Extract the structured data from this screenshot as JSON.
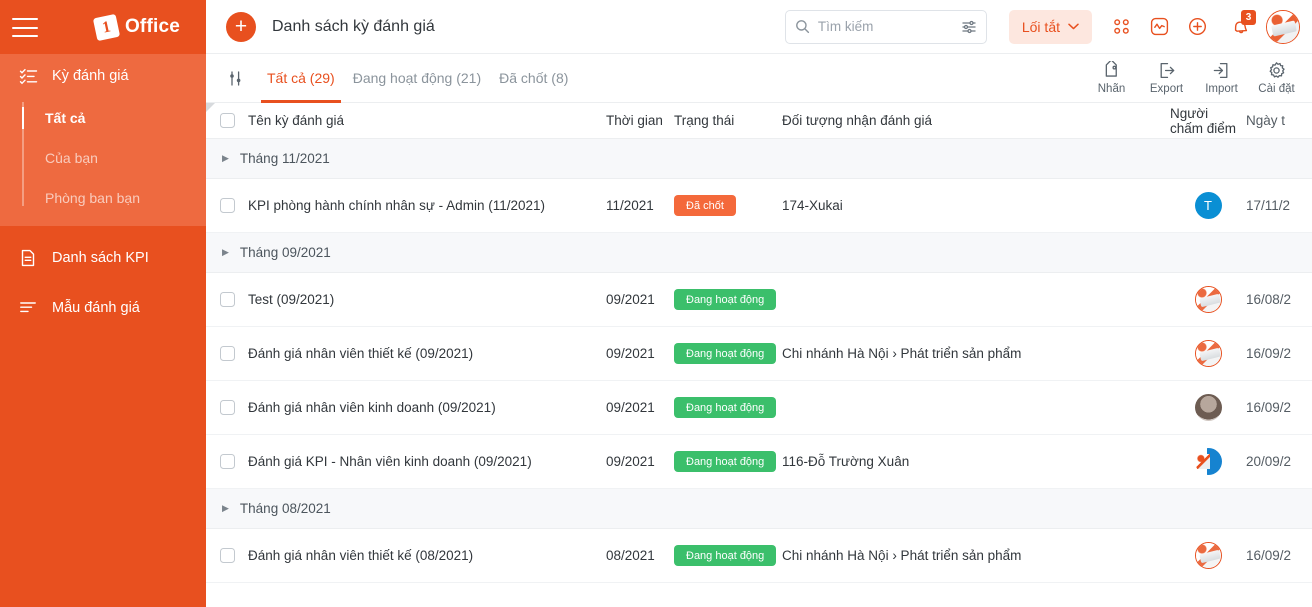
{
  "sidebar": {
    "menu_icon": "hamburger-icon",
    "brand": {
      "mark": "1",
      "text": "Office"
    },
    "active_section": {
      "label": "Kỳ đánh giá",
      "icon": "checklist-icon",
      "subitems": [
        {
          "label": "Tất cả",
          "active": true
        },
        {
          "label": "Của bạn",
          "active": false
        },
        {
          "label": "Phòng ban bạn",
          "active": false
        }
      ]
    },
    "items": [
      {
        "label": "Danh sách KPI",
        "icon": "document-icon"
      },
      {
        "label": "Mẫu đánh giá",
        "icon": "list-lines-icon"
      }
    ]
  },
  "topbar": {
    "add_button": "+",
    "title": "Danh sách kỳ đánh giá",
    "search": {
      "placeholder": "Tìm kiếm",
      "value": "",
      "icon": "search-icon",
      "filter_icon": "sliders-icon"
    },
    "shortcut": {
      "label": "Lối tắt",
      "chevron": "chevron-down-icon"
    },
    "icons": [
      {
        "name": "apps-grid-icon"
      },
      {
        "name": "activity-chart-icon"
      },
      {
        "name": "plus-circle-icon"
      },
      {
        "name": "notification-bell-icon",
        "badge": "3"
      }
    ],
    "avatar": {
      "name": "user-avatar"
    }
  },
  "tabbar": {
    "filter_icon": "filter-settings-icon",
    "tabs": [
      {
        "label": "Tất cả (29)",
        "active": true
      },
      {
        "label": "Đang hoạt động (21)",
        "active": false
      },
      {
        "label": "Đã chốt (8)",
        "active": false
      }
    ],
    "tools": [
      {
        "label": "Nhãn",
        "icon": "tag-icon"
      },
      {
        "label": "Export",
        "icon": "export-icon"
      },
      {
        "label": "Import",
        "icon": "import-icon"
      },
      {
        "label": "Cài đặt",
        "icon": "gear-icon"
      }
    ]
  },
  "table": {
    "columns": [
      "Tên kỳ đánh giá",
      "Thời gian",
      "Trạng thái",
      "Đối tượng nhận đánh giá",
      "Người chấm điểm",
      "Ngày t"
    ],
    "groups": [
      {
        "label": "Tháng 11/2021",
        "rows": [
          {
            "name": "KPI phòng hành chính nhân sự - Admin (11/2021)",
            "time": "11/2021",
            "status": "Đã chốt",
            "status_type": "closed",
            "target": "174-Xukai",
            "grader": "T",
            "grader_type": "initial",
            "date": "17/11/2"
          }
        ]
      },
      {
        "label": "Tháng 09/2021",
        "rows": [
          {
            "name": "Test (09/2021)",
            "time": "09/2021",
            "status": "Đang hoạt động",
            "status_type": "active",
            "target": "",
            "grader": "",
            "grader_type": "art",
            "date": "16/08/2"
          },
          {
            "name": "Đánh giá nhân viên thiết kế (09/2021)",
            "time": "09/2021",
            "status": "Đang hoạt động",
            "status_type": "active",
            "target": "Chi nhánh Hà Nội › Phát triển sản phẩm",
            "grader": "",
            "grader_type": "art",
            "date": "16/09/2"
          },
          {
            "name": "Đánh giá nhân viên kinh doanh (09/2021)",
            "time": "09/2021",
            "status": "Đang hoạt động",
            "status_type": "active",
            "target": "",
            "grader": "",
            "grader_type": "photo",
            "date": "16/09/2"
          },
          {
            "name": "Đánh giá KPI - Nhân viên kinh doanh (09/2021)",
            "time": "09/2021",
            "status": "Đang hoạt động",
            "status_type": "active",
            "target": "116-Đỗ Trường Xuân",
            "grader": "",
            "grader_type": "split",
            "date": "20/09/2"
          }
        ]
      },
      {
        "label": "Tháng 08/2021",
        "rows": [
          {
            "name": "Đánh giá nhân viên thiết kế (08/2021)",
            "time": "08/2021",
            "status": "Đang hoạt động",
            "status_type": "active",
            "target": "Chi nhánh Hà Nội › Phát triển sản phẩm",
            "grader": "",
            "grader_type": "art",
            "date": "16/09/2"
          }
        ]
      }
    ]
  },
  "colors": {
    "brand_orange": "#E8501F",
    "sidebar_active": "#EE6A40",
    "status_closed": "#F4693B",
    "status_active": "#3BBF6B",
    "shortcut_bg": "#FDE7DF",
    "avatar_blue": "#0A8FD4"
  }
}
